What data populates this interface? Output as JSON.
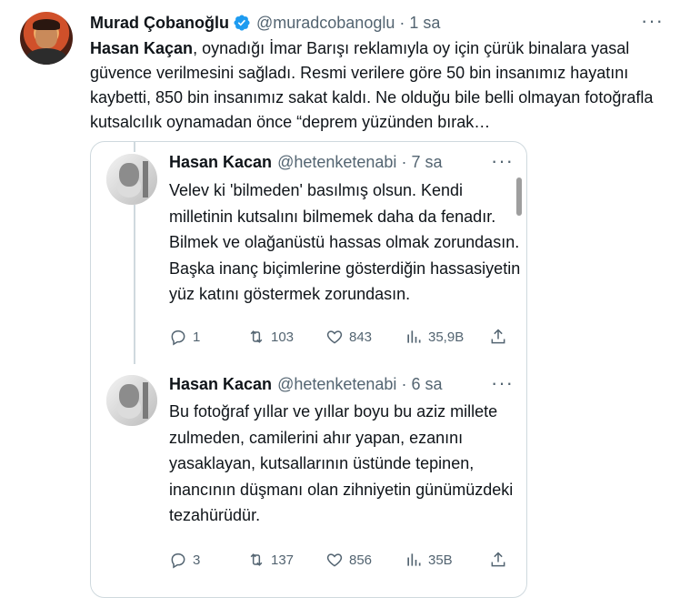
{
  "main_tweet": {
    "author_name": "Murad Çobanoğlu",
    "handle": "@muradcobanoglu",
    "separator": "·",
    "time": "1 sa",
    "more_label": "···",
    "text_bold": "Hasan Kaçan",
    "text_rest": ", oynadığı İmar Barışı reklamıyla oy için çürük binalara yasal güvence verilmesini sağladı. Resmi verilere göre 50 bin insanımız hayatını kaybetti, 850 bin insanımız sakat kaldı. Ne olduğu bile belli olmayan fotoğrafla kutsalcılık oynamadan önce “deprem yüzünden bırak…"
  },
  "quoted_tweets": [
    {
      "author_name": "Hasan Kacan",
      "handle": "@hetenketenabi",
      "separator": "·",
      "time": "7 sa",
      "more_label": "···",
      "text": "Velev ki 'bilmeden' basılmış olsun. Kendi milletinin kutsalını bilmemek daha da fenadır. Bilmek ve olağanüstü hassas olmak zorundasın. Başka inanç biçimlerine gösterdiğin hassasiyetin yüz katını göstermek zorundasın.",
      "replies": "1",
      "retweets": "103",
      "likes": "843",
      "views": "35,9B"
    },
    {
      "author_name": "Hasan Kacan",
      "handle": "@hetenketenabi",
      "separator": "·",
      "time": "6 sa",
      "more_label": "···",
      "text": "Bu fotoğraf yıllar ve yıllar boyu bu aziz millete zulmeden, camilerini ahır yapan, ezanını yasaklayan, kutsallarının üstünde tepinen, inancının düşmanı olan zihniyetin günümüzdeki tezahürüdür.",
      "replies": "3",
      "retweets": "137",
      "likes": "856",
      "views": "35B"
    }
  ],
  "colors": {
    "verified": "#1d9bf0",
    "secondary_text": "#536471",
    "border": "#cfd9de"
  },
  "icons": [
    "verified-badge-icon",
    "more-icon",
    "reply-icon",
    "retweet-icon",
    "like-icon",
    "views-icon",
    "share-icon"
  ]
}
